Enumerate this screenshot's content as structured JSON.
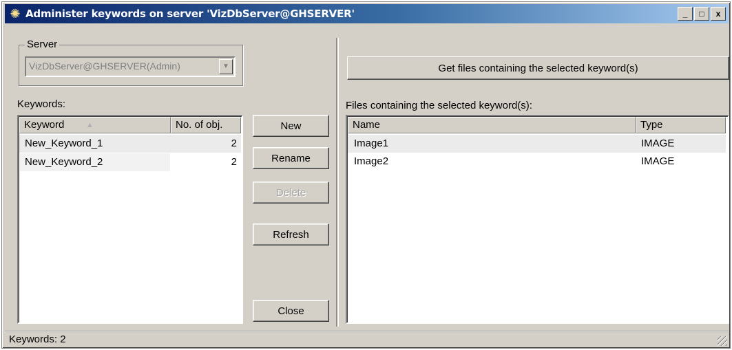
{
  "window": {
    "title": "Administer keywords on server 'VizDbServer@GHSERVER'",
    "app_icon": "gear-icon",
    "controls": {
      "minimize": "_",
      "maximize": "□",
      "close": "x"
    }
  },
  "server_group": {
    "legend": "Server",
    "value": "VizDbServer@GHSERVER(Admin)",
    "dropdown_icon": "chevron-down-icon"
  },
  "keywords": {
    "label": "Keywords:",
    "columns": [
      "Keyword",
      "No. of obj."
    ],
    "rows": [
      {
        "keyword": "New_Keyword_1",
        "count": "2"
      },
      {
        "keyword": "New_Keyword_2",
        "count": "2"
      }
    ]
  },
  "buttons": {
    "new": "New",
    "rename": "Rename",
    "delete": "Delete",
    "refresh": "Refresh",
    "close": "Close",
    "get_files": "Get files containing the selected keyword(s)"
  },
  "files": {
    "label": "Files containing the selected keyword(s):",
    "columns": [
      "Name",
      "Type"
    ],
    "rows": [
      {
        "name": "Image1",
        "type": "IMAGE"
      },
      {
        "name": "Image2",
        "type": "IMAGE"
      }
    ]
  },
  "status": {
    "text": "Keywords: 2"
  },
  "colors": {
    "face": "#d4d0c8",
    "title_start": "#0a246a",
    "title_end": "#a6caf0",
    "selection": "#ebebeb"
  }
}
